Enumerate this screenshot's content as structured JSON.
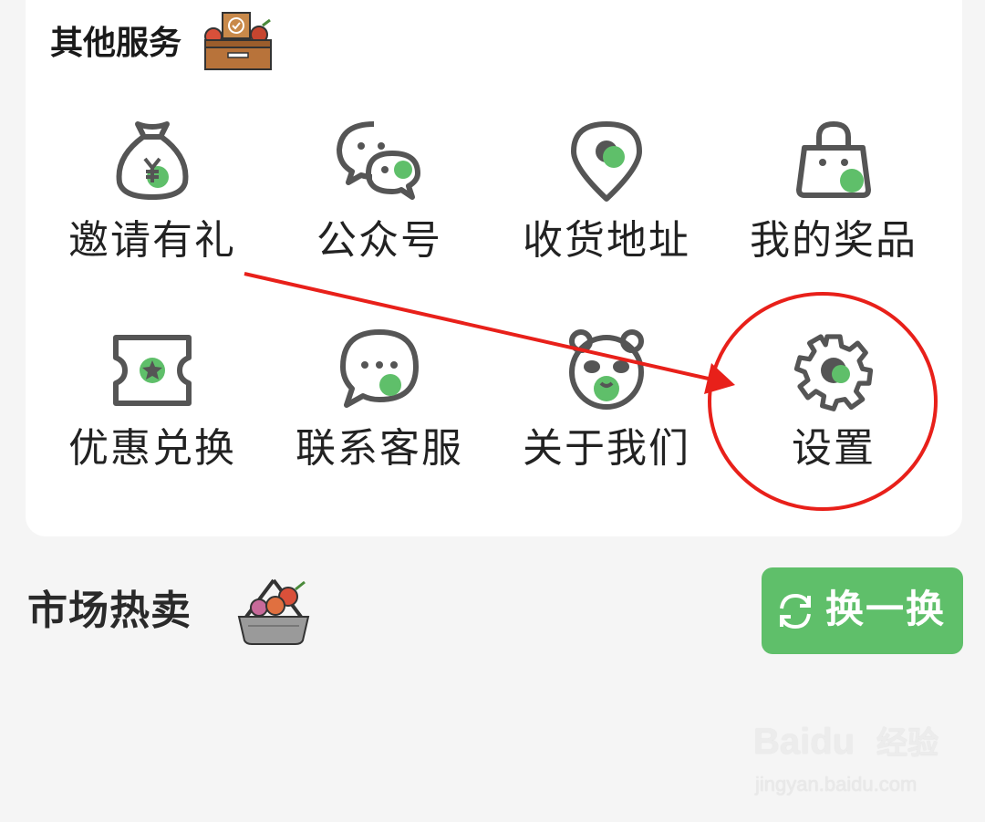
{
  "other_services": {
    "title": "其他服务",
    "title_icon": "drawer-box-icon",
    "items": [
      {
        "label": "邀请有礼",
        "icon": "money-bag-icon"
      },
      {
        "label": "公众号",
        "icon": "wechat-icon"
      },
      {
        "label": "收货地址",
        "icon": "location-pin-icon"
      },
      {
        "label": "我的奖品",
        "icon": "shopping-bag-icon"
      },
      {
        "label": "优惠兑换",
        "icon": "coupon-ticket-icon"
      },
      {
        "label": "联系客服",
        "icon": "chat-bubble-icon"
      },
      {
        "label": "关于我们",
        "icon": "panda-icon"
      },
      {
        "label": "设置",
        "icon": "gear-icon"
      }
    ]
  },
  "market_hot": {
    "title": "市场热卖",
    "title_icon": "basket-icon",
    "refresh_label": "换一换",
    "refresh_icon": "refresh-icon"
  },
  "watermark": {
    "brand": "Baidu",
    "sub": "经验",
    "url": "jingyan.baidu.com"
  },
  "colors": {
    "accent_green": "#5fbf6a",
    "icon_gray": "#555555",
    "annotation_red": "#e8201a"
  }
}
